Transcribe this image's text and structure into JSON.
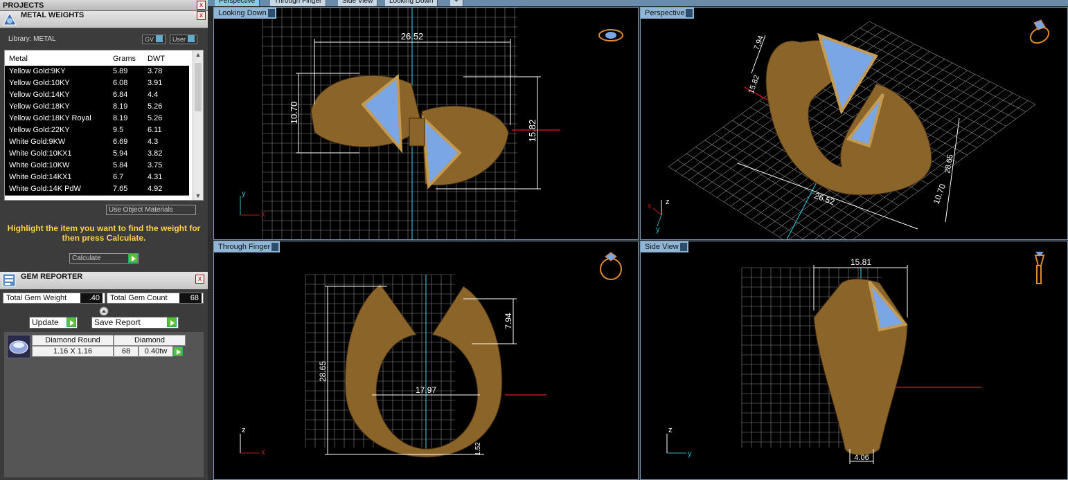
{
  "tabs": [
    "Perspective",
    "Through Finger",
    "Side View",
    "Looking Down",
    "+"
  ],
  "projects": {
    "title": "PROJECTS",
    "close": "x"
  },
  "metal": {
    "title": "METAL WEIGHTS",
    "library": "Library: METAL",
    "gv": "GV",
    "user": "User",
    "columns": [
      "Metal",
      "Grams",
      "DWT"
    ],
    "rows": [
      [
        "Yellow Gold:9KY",
        "5.89",
        "3.78"
      ],
      [
        "Yellow Gold:10KY",
        "6.08",
        "3.91"
      ],
      [
        "Yellow Gold:14KY",
        "6.84",
        "4.4"
      ],
      [
        "Yellow Gold:18KY",
        "8.19",
        "5.26"
      ],
      [
        "Yellow Gold:18KY Royal",
        "8.19",
        "5.26"
      ],
      [
        "Yellow Gold:22KY",
        "9.5",
        "6.11"
      ],
      [
        "White Gold:9KW",
        "6.69",
        "4.3"
      ],
      [
        "White Gold:10KX1",
        "5.94",
        "3.82"
      ],
      [
        "White Gold:10KW",
        "5.84",
        "3.75"
      ],
      [
        "White Gold:14KX1",
        "6.7",
        "4.31"
      ],
      [
        "White Gold:14K PdW",
        "7.65",
        "4.92"
      ]
    ],
    "use_object_materials": "Use Object Materials",
    "hint": "Highlight the item you want to find the weight for then press Calculate.",
    "calculate": "Calculate"
  },
  "gem": {
    "title": "GEM REPORTER",
    "total_weight_label": "Total Gem Weight",
    "total_weight": ".40",
    "total_count_label": "Total Gem Count",
    "total_count": "68",
    "update": "Update",
    "save_report": "Save Report",
    "row": {
      "shape": "Diamond Round",
      "type": "Diamond",
      "size": "1.16 X 1.16",
      "count": "68",
      "weight": "0.40tw"
    }
  },
  "viewports": {
    "looking_down": {
      "label": "Looking Down",
      "dims": [
        "26.52",
        "10.70",
        "15.82"
      ]
    },
    "perspective": {
      "label": "Perspective",
      "dims": [
        "7.94",
        "15.82",
        "26.52",
        "10.70",
        "28.65"
      ]
    },
    "through_finger": {
      "label": "Through Finger",
      "dims": [
        "7.94",
        "28.65",
        "17.97",
        "1.52"
      ]
    },
    "side_view": {
      "label": "Side View",
      "dims": [
        "15.81",
        "4.06"
      ]
    }
  },
  "axes": {
    "x": "x",
    "y": "y",
    "z": "z"
  },
  "colors": {
    "gold": "#8a6428",
    "gold_light": "#c49a52",
    "gem": "#7aa6e6",
    "grid": "#8a8a8a",
    "dim": "#ffffff",
    "accent": "#2fb6c8",
    "red": "#c01818"
  }
}
